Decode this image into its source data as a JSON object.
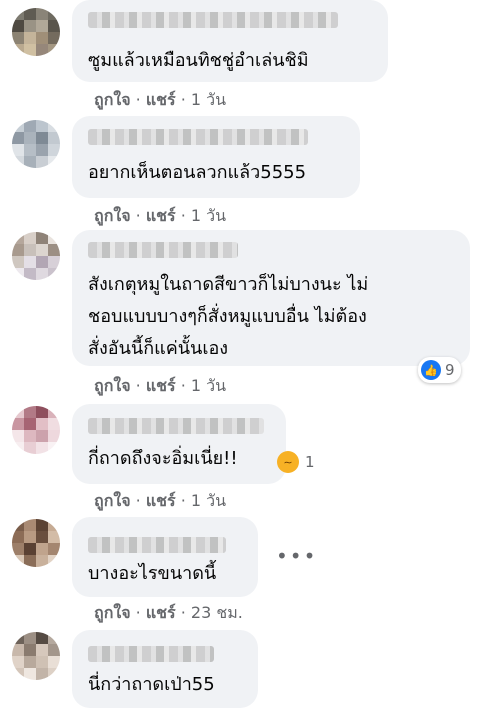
{
  "comments": [
    {
      "text_lines": [
        "ซูมแล้วเหมือนทิชชู่อำเล่นชิมิ"
      ],
      "like_label": "ถูกใจ",
      "reply_label": "แชร์",
      "time": "1 วัน"
    },
    {
      "text_lines": [
        "อยากเห็นตอนลวกแล้ว5555"
      ],
      "like_label": "ถูกใจ",
      "reply_label": "แชร์",
      "time": "1 วัน"
    },
    {
      "text_lines": [
        "สังเกตุหมูในถาดสีขาวก็ไม่บางนะ ไม่",
        "ชอบแบบบางๆก็สั่งหมูแบบอื่น ไม่ต้อง",
        "สั่งอันนี้ก็แค่นั้นเอง"
      ],
      "like_label": "ถูกใจ",
      "reply_label": "แชร์",
      "time": "1 วัน",
      "reaction_icon": "like-icon",
      "reaction_count": "9"
    },
    {
      "text_lines": [
        "กี่ถาดถึงจะอิ่มเนี่ย!!"
      ],
      "like_label": "ถูกใจ",
      "reply_label": "แชร์",
      "time": "1 วัน",
      "reaction_icon": "haha-icon",
      "reaction_count": "1"
    },
    {
      "text_lines": [
        "บางอะไรขนาดนี้"
      ],
      "like_label": "ถูกใจ",
      "reply_label": "แชร์",
      "time": "23 ชม.",
      "more_icon": "more-options-icon"
    },
    {
      "text_lines": [
        "นี่กว่าถาดเป่า55"
      ]
    }
  ],
  "separator": "·"
}
